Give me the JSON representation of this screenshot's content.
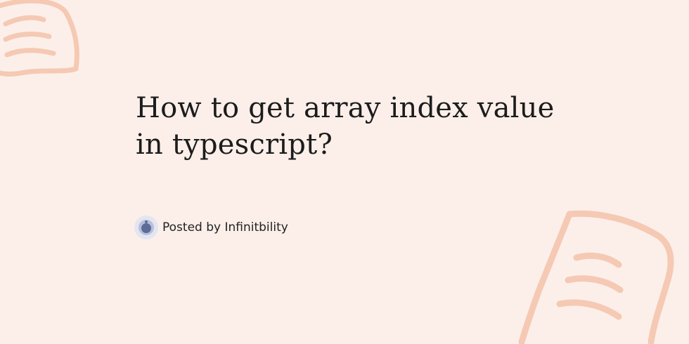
{
  "post": {
    "title_line_1": "How to get array index value",
    "title_line_2": "in typescript?",
    "posted_by": "Posted by Infinitbility"
  },
  "theme": {
    "background": "#fcefea",
    "decor_stroke": "#f5c9b3",
    "text": "#1c1c1c",
    "avatar_ring": "#e3e6f0",
    "avatar_core": "#5d6b99"
  },
  "icons": {
    "avatar": "profile-avatar-icon",
    "decor": "speech-bubble-doodle-icon"
  }
}
